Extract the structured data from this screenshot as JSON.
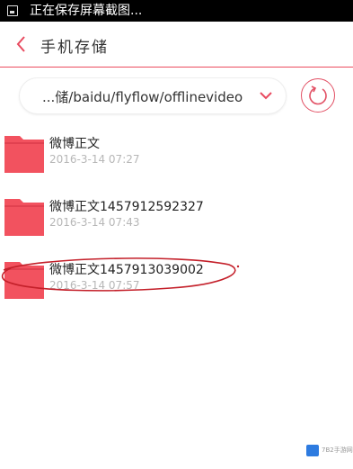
{
  "status_bar": {
    "text": "正在保存屏幕截图...",
    "icon": "screenshot-icon"
  },
  "header": {
    "title": "手机存储",
    "back_icon": "chevron-left-icon"
  },
  "path_bar": {
    "path": "...储/baidu/flyflow/offlinevideo",
    "dropdown_icon": "chevron-down-icon",
    "refresh_icon": "refresh-icon"
  },
  "files": [
    {
      "name": "微博正文",
      "date": "2016-3-14 07:27",
      "icon": "folder-icon"
    },
    {
      "name": "微博正文1457912592327",
      "date": "2016-3-14 07:43",
      "icon": "folder-icon"
    },
    {
      "name": "微博正文1457913039002",
      "date": "2016-3-14 07:57",
      "icon": "folder-icon"
    }
  ],
  "watermark": {
    "text": "7B2手游网"
  },
  "colors": {
    "accent": "#e84a5f",
    "folder": "#f2525f",
    "date_text": "#b7b7b7"
  }
}
